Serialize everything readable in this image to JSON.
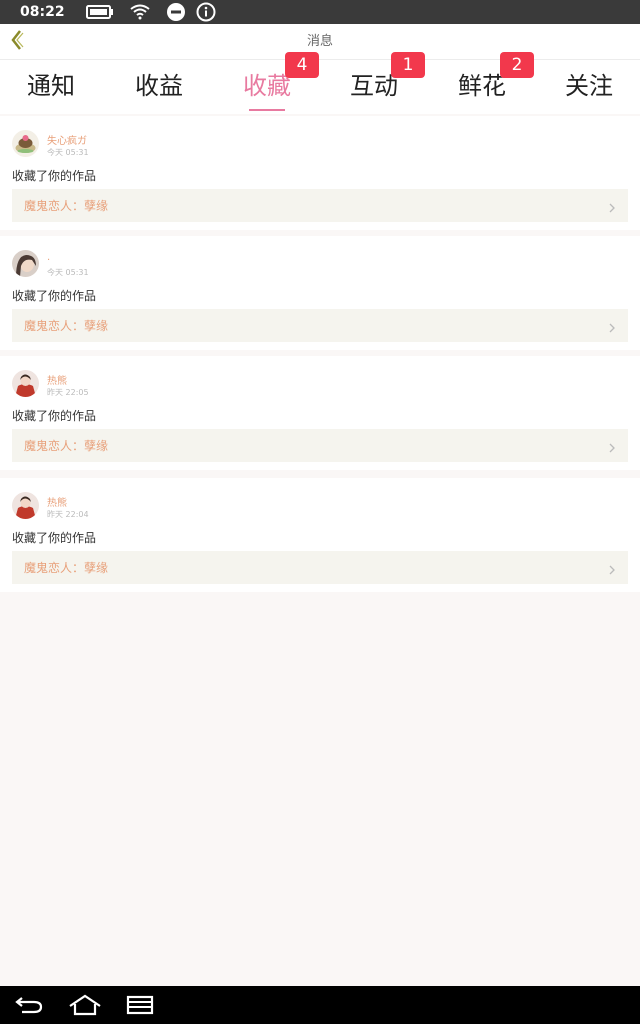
{
  "status_bar": {
    "time": "08:22",
    "icons": [
      "battery-icon",
      "wifi-icon",
      "do-not-disturb-icon",
      "info-icon"
    ]
  },
  "header": {
    "back_icon": "chevron-left-icon",
    "title": "消息"
  },
  "tabs": [
    {
      "label": "通知",
      "badge": null,
      "active": false
    },
    {
      "label": "收益",
      "badge": null,
      "active": false
    },
    {
      "label": "收藏",
      "badge": "4",
      "active": true
    },
    {
      "label": "互动",
      "badge": "1",
      "active": false
    },
    {
      "label": "鲜花",
      "badge": "2",
      "active": false
    },
    {
      "label": "关注",
      "badge": null,
      "active": false
    }
  ],
  "messages": [
    {
      "user": "失心疯ガ",
      "time": "今天 05:31",
      "action": "收藏了你的作品",
      "work": "魔鬼恋人：孽缘"
    },
    {
      "user": ".",
      "time": "今天 05:31",
      "action": "收藏了你的作品",
      "work": "魔鬼恋人：孽缘"
    },
    {
      "user": "热熊",
      "time": "昨天 22:05",
      "action": "收藏了你的作品",
      "work": "魔鬼恋人：孽缘"
    },
    {
      "user": "热熊",
      "time": "昨天 22:04",
      "action": "收藏了你的作品",
      "work": "魔鬼恋人：孽缘"
    }
  ],
  "nav_bar": {
    "icons": [
      "back-nav-icon",
      "home-nav-icon",
      "recent-apps-icon"
    ]
  },
  "colors": {
    "accent": "#e87aa0",
    "badge": "#f2384c",
    "username": "#e8a07a"
  }
}
